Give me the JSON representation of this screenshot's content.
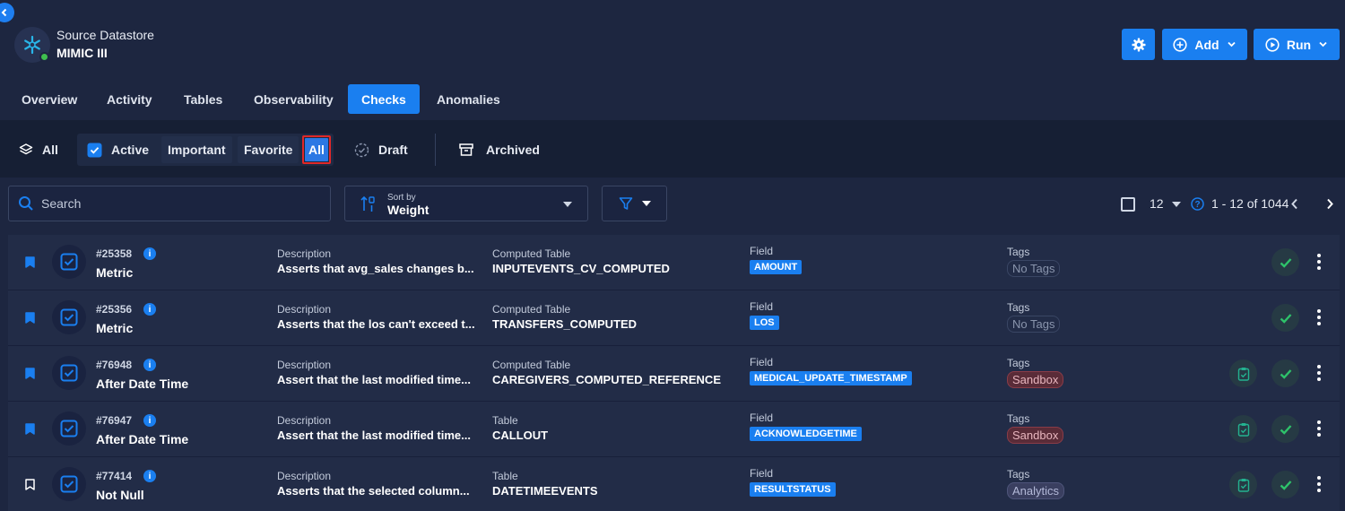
{
  "header": {
    "subtitle": "Source Datastore",
    "title": "MIMIC III",
    "add_label": "Add",
    "run_label": "Run"
  },
  "tabs": [
    "Overview",
    "Activity",
    "Tables",
    "Observability",
    "Checks",
    "Anomalies"
  ],
  "active_tab": "Checks",
  "filters": {
    "all": "All",
    "active": "Active",
    "important": "Important",
    "favorite": "Favorite",
    "active_all": "All",
    "draft": "Draft",
    "archived": "Archived"
  },
  "toolbar": {
    "search_placeholder": "Search",
    "sort_label": "Sort by",
    "sort_value": "Weight",
    "page_size": "12",
    "range": "1 - 12 of 1044"
  },
  "columns": {
    "description": "Description",
    "field": "Field",
    "tags": "Tags"
  },
  "rows": [
    {
      "id": "#25358",
      "type": "Metric",
      "description": "Asserts that avg_sales changes b...",
      "table_label": "Computed Table",
      "table": "INPUTEVENTS_CV_COMPUTED",
      "field": "AMOUNT",
      "tag": "No Tags",
      "tag_kind": "none",
      "bookmarked": true,
      "extra_icon": false
    },
    {
      "id": "#25356",
      "type": "Metric",
      "description": "Asserts that the los can't exceed t...",
      "table_label": "Computed Table",
      "table": "TRANSFERS_COMPUTED",
      "field": "LOS",
      "tag": "No Tags",
      "tag_kind": "none",
      "bookmarked": true,
      "extra_icon": false
    },
    {
      "id": "#76948",
      "type": "After Date Time",
      "description": "Assert that the last modified time...",
      "table_label": "Computed Table",
      "table": "CAREGIVERS_COMPUTED_REFERENCE",
      "field": "MEDICAL_UPDATE_TIMESTAMP",
      "tag": "Sandbox",
      "tag_kind": "sandbox",
      "bookmarked": true,
      "extra_icon": true
    },
    {
      "id": "#76947",
      "type": "After Date Time",
      "description": "Assert that the last modified time...",
      "table_label": "Table",
      "table": "CALLOUT",
      "field": "ACKNOWLEDGETIME",
      "tag": "Sandbox",
      "tag_kind": "sandbox",
      "bookmarked": true,
      "extra_icon": true
    },
    {
      "id": "#77414",
      "type": "Not Null",
      "description": "Asserts that the selected column...",
      "table_label": "Table",
      "table": "DATETIMEEVENTS",
      "field": "RESULTSTATUS",
      "tag": "Analytics",
      "tag_kind": "analytics",
      "bookmarked": false,
      "extra_icon": true
    }
  ]
}
